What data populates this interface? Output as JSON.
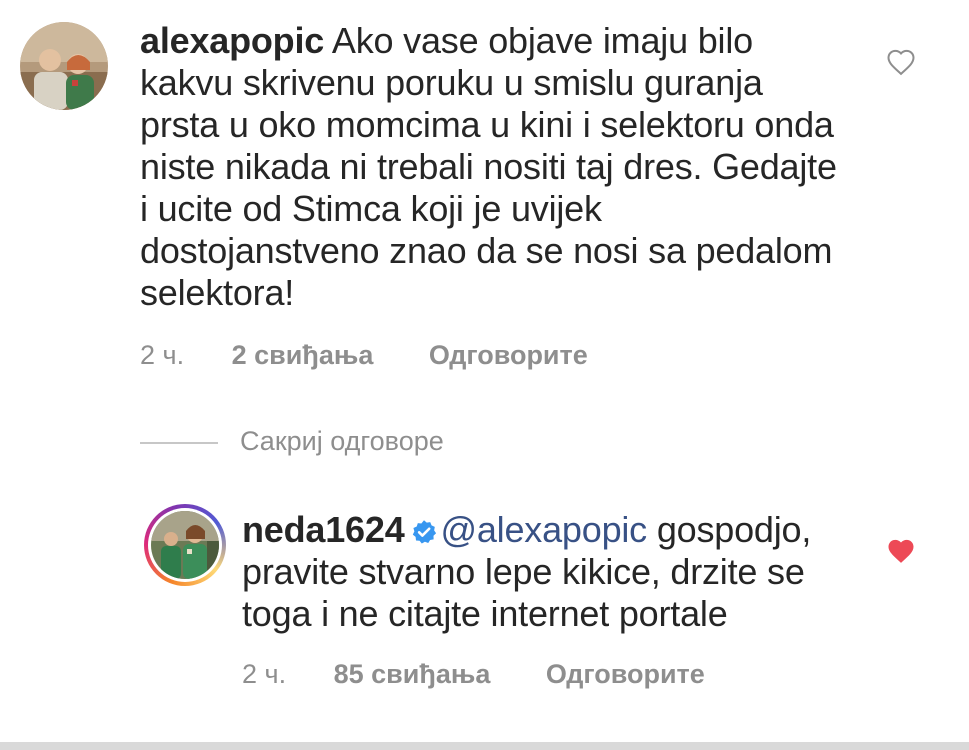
{
  "comment": {
    "username": "alexapopic",
    "text": "Ako vase objave imaju bilo kakvu skrivenu poruku u smislu guranja prsta u oko momcima u kini i selektoru onda niste nikada ni trebali nositi taj dres. Gedajte i ucite od Stimca koji je uvijek dostojanstveno znao da se nosi sa pedalom selektora!",
    "time": "2 ч.",
    "likes": "2 свиђања",
    "reply_label": "Одговорите",
    "liked": false
  },
  "hide_replies_label": "Сакриј одговоре",
  "reply": {
    "username": "neda1624",
    "verified": true,
    "mention": "@alexapopic",
    "text": "gospodjo, pravite stvarno lepe kikice, drzite se toga i ne citajte internet portale",
    "time": "2 ч.",
    "likes": "85 свиђања",
    "reply_label": "Одговорите",
    "liked": true
  },
  "colors": {
    "text": "#262626",
    "secondary": "#8e8e8e",
    "mention": "#385185",
    "verified": "#3897f0",
    "heart_liked": "#ed4956"
  },
  "icons": {
    "like": "heart-outline-icon",
    "liked": "heart-filled-icon",
    "verified": "verified-badge-icon"
  }
}
